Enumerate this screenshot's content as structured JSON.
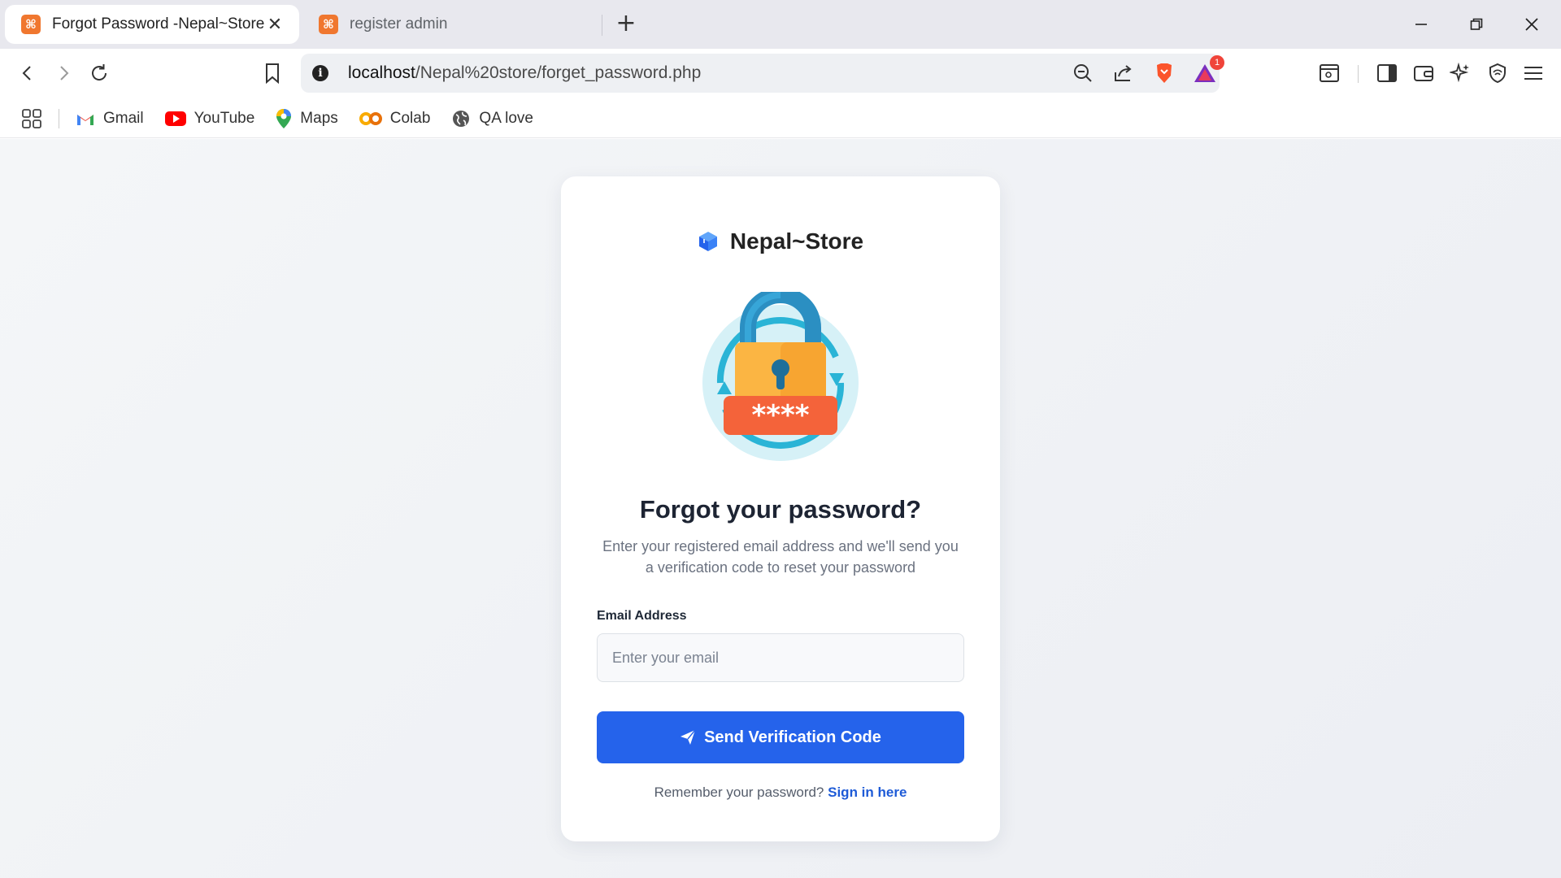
{
  "browser": {
    "tabs": [
      {
        "title": "Forgot Password -Nepal~Store",
        "active": true,
        "favicon": "xampp-icon"
      },
      {
        "title": "register admin",
        "active": false,
        "favicon": "xampp-icon"
      }
    ],
    "url": {
      "host": "localhost",
      "path": "/Nepal%20store/forget_password.php"
    },
    "brave_badge": "1",
    "bookmarks": [
      {
        "label": "Gmail",
        "icon": "gmail-icon"
      },
      {
        "label": "YouTube",
        "icon": "youtube-icon"
      },
      {
        "label": "Maps",
        "icon": "maps-icon"
      },
      {
        "label": "Colab",
        "icon": "colab-icon"
      },
      {
        "label": "QA love",
        "icon": "globe-icon"
      }
    ]
  },
  "card": {
    "brand": "Nepal~Store",
    "heading": "Forgot your password?",
    "subtext": "Enter your registered email address and we'll send you a verification code to reset your password",
    "email_label": "Email Address",
    "email_placeholder": "Enter your email",
    "email_value": "",
    "submit_label": "Send Verification Code",
    "footer_text": "Remember your password?",
    "footer_link": "Sign in here"
  },
  "colors": {
    "primary": "#2563eb",
    "link": "#1e5bd7",
    "tab_accent": "#f0772f"
  }
}
